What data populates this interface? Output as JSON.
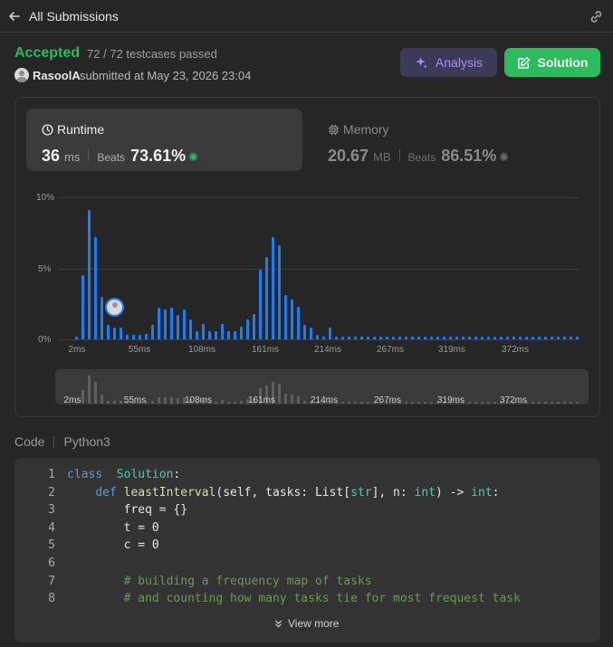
{
  "header": {
    "title": "All Submissions",
    "back_icon": "arrow-left-icon",
    "link_icon": "link-icon"
  },
  "submission": {
    "status": "Accepted",
    "testcases": "72 / 72 testcases passed",
    "username": "RasoolA",
    "submitted_at": "submitted at May 23, 2026 23:04"
  },
  "buttons": {
    "analysis": "Analysis",
    "solution": "Solution"
  },
  "runtime": {
    "title": "Runtime",
    "value": "36",
    "unit": "ms",
    "beats_label": "Beats",
    "beats": "73.61%"
  },
  "memory": {
    "title": "Memory",
    "value": "20.67",
    "unit": "MB",
    "beats_label": "Beats",
    "beats": "86.51%"
  },
  "colors": {
    "accent_green": "#2cbb5d",
    "bar_blue": "#1a7df6",
    "analysis_purple": "#a78bfa"
  },
  "chart_data": {
    "type": "bar",
    "ylim": [
      0,
      10
    ],
    "ytick_labels": [
      "10%",
      "5%",
      "0%"
    ],
    "xtick_labels": [
      "2ms",
      "55ms",
      "108ms",
      "161ms",
      "214ms",
      "267ms",
      "319ms",
      "372ms"
    ],
    "marker": "36 ms",
    "values": [
      0.2,
      4.5,
      9.1,
      7.2,
      3.0,
      1.0,
      0.8,
      0.8,
      0.3,
      0.3,
      0.3,
      0.4,
      1.0,
      2.2,
      2.1,
      2.2,
      1.7,
      2.1,
      1.4,
      0.6,
      1.1,
      0.6,
      0.6,
      1.1,
      0.6,
      0.6,
      0.9,
      1.4,
      1.8,
      4.9,
      5.8,
      7.2,
      6.6,
      3.1,
      2.8,
      2.3,
      1.0,
      0.8,
      0.3,
      0.2,
      0.8,
      0.2,
      0.2,
      0.2,
      0.2,
      0.2,
      0.2,
      0.2,
      0.2,
      0.2,
      0.2,
      0.2,
      0.2,
      0.2,
      0.2,
      0.2,
      0.2,
      0.2,
      0.2,
      0.2,
      0.2,
      0.2,
      0.2,
      0.2,
      0.2,
      0.2,
      0.2,
      0.2,
      0.2,
      0.2,
      0.2,
      0.2,
      0.2,
      0.2,
      0.2,
      0.2,
      0.2,
      0.2,
      0.2,
      0.2
    ]
  },
  "code": {
    "label": "Code",
    "language": "Python3",
    "view_more": "View more",
    "lines": [
      {
        "n": "1",
        "indent": "",
        "tokens": [
          [
            "kw",
            "class"
          ],
          [
            "",
            "  "
          ],
          [
            "cls",
            "Solution"
          ],
          [
            "",
            ":"
          ]
        ]
      },
      {
        "n": "2",
        "indent": "    ",
        "tokens": [
          [
            "kw",
            "def"
          ],
          [
            "",
            " "
          ],
          [
            "fn",
            "leastInterval"
          ],
          [
            "",
            "(self, tasks: List["
          ],
          [
            "ty",
            "str"
          ],
          [
            "",
            "], n: "
          ],
          [
            "ty",
            "int"
          ],
          [
            "",
            ") -> "
          ],
          [
            "ty",
            "int"
          ],
          [
            "",
            ":"
          ]
        ]
      },
      {
        "n": "3",
        "indent": "        ",
        "tokens": [
          [
            "",
            "freq = {}"
          ]
        ]
      },
      {
        "n": "4",
        "indent": "        ",
        "tokens": [
          [
            "",
            "t = 0"
          ]
        ]
      },
      {
        "n": "5",
        "indent": "        ",
        "tokens": [
          [
            "",
            "c = 0"
          ]
        ]
      },
      {
        "n": "6",
        "indent": "",
        "tokens": []
      },
      {
        "n": "7",
        "indent": "        ",
        "tokens": [
          [
            "cm",
            "# building a frequency map of tasks"
          ]
        ]
      },
      {
        "n": "8",
        "indent": "        ",
        "tokens": [
          [
            "cm",
            "# and counting how many tasks tie for most frequest task"
          ]
        ]
      }
    ]
  }
}
